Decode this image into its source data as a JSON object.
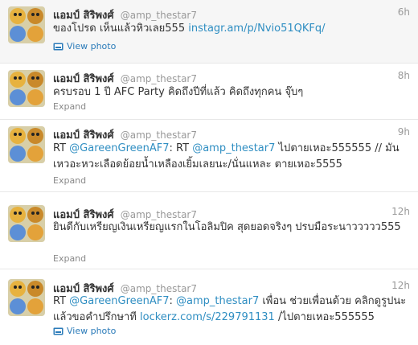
{
  "feed": {
    "tweets": [
      {
        "fullname": "แอมป์ สิริพงศ์",
        "username": "@amp_thestar7",
        "time": "6h",
        "text": "ของโปรด เห็นแล้วหิวเลย555 ",
        "link": "instagr.am/p/Nvio51QKFq/",
        "action": "View photo"
      },
      {
        "fullname": "แอมป์ สิริพงศ์",
        "username": "@amp_thestar7",
        "time": "8h",
        "text": "ครบรอบ 1 ปี AFC Party คิดถึงปีที่แล้ว คิดถึงทุกคน จุ๊บๆ",
        "action": "Expand"
      },
      {
        "fullname": "แอมป์ สิริพงศ์",
        "username": "@amp_thestar7",
        "time": "9h",
        "text_prefix": "RT ",
        "mention1": "@GareenGreenAF7",
        "text_mid": ": RT ",
        "mention2": "@amp_thestar7",
        "text_suffix": " ไปตายเหอะ555555 // มันเหวอะหวะเลือดย้อยน้ำเหลืองเยิ้มเลยนะ/นั่นแหละ ตายเหอะ5555",
        "action": "Expand"
      },
      {
        "fullname": "แอมป์ สิริพงศ์",
        "username": "@amp_thestar7",
        "time": "12h",
        "text": "ยินดีกับเหรียญเงินเหรียญแรกในโอลิมปิค สุดยอดจริงๆ ปรบมือระนาววววว555",
        "action": "Expand"
      },
      {
        "fullname": "แอมป์ สิริพงศ์",
        "username": "@amp_thestar7",
        "time": "12h",
        "text_prefix": "RT ",
        "mention1": "@GareenGreenAF7",
        "text_mid": ": ",
        "mention2": "@amp_thestar7",
        "text_suffix": " เพื่อน ช่วยเพื่อนด้วย คลิกดูรูปนะแล้วขอคำปรึกษาที ",
        "link": "lockerz.com/s/229791131",
        "text_end": " /ไปตายเหอะ555555",
        "action": "View photo"
      }
    ]
  },
  "colors": {
    "link": "#2f8ec2",
    "muted": "#999999"
  }
}
